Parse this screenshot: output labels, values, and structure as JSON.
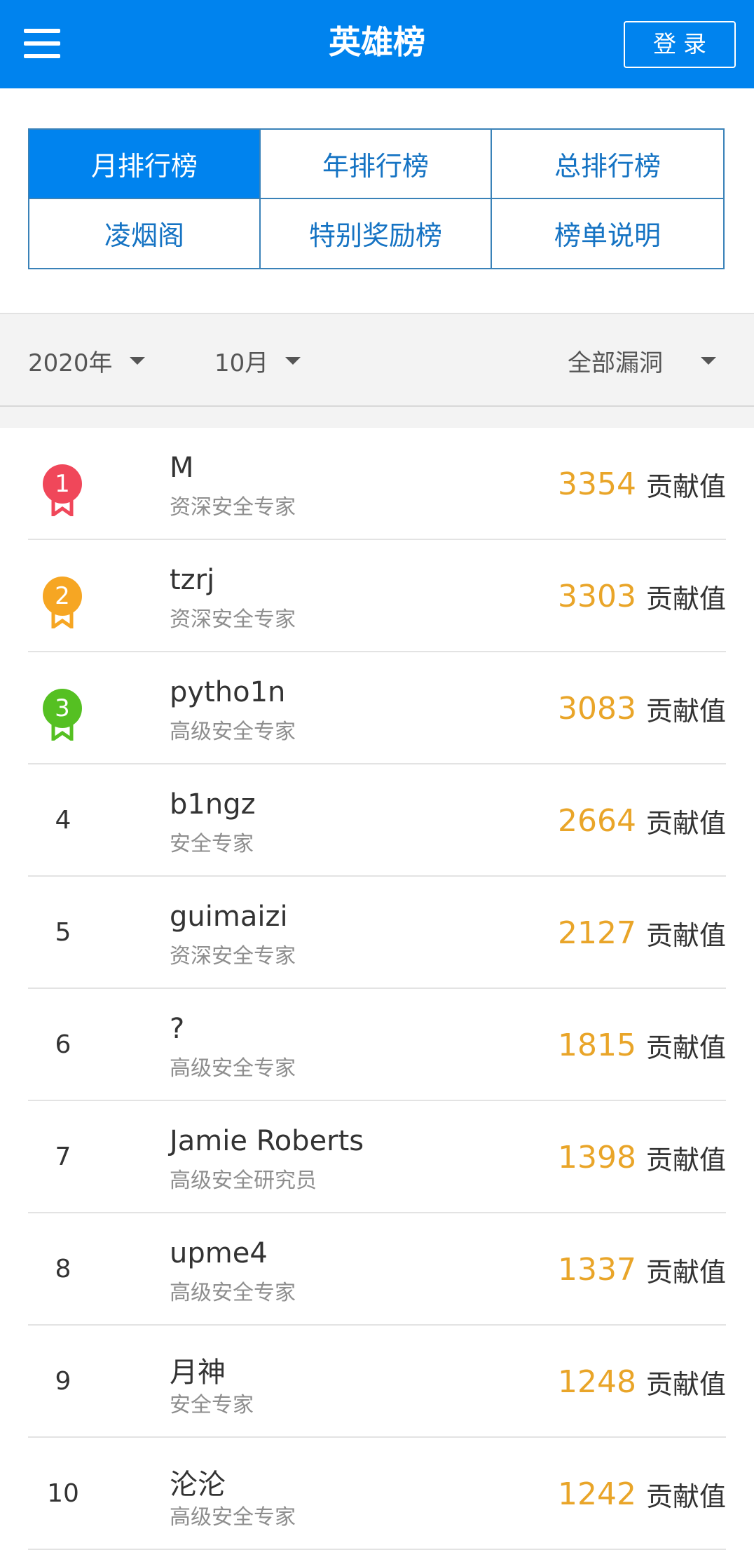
{
  "header": {
    "title": "英雄榜",
    "login_label": "登录"
  },
  "tabs": [
    {
      "label": "月排行榜",
      "active": true
    },
    {
      "label": "年排行榜",
      "active": false
    },
    {
      "label": "总排行榜",
      "active": false
    },
    {
      "label": "凌烟阁",
      "active": false
    },
    {
      "label": "特别奖励榜",
      "active": false
    },
    {
      "label": "榜单说明",
      "active": false
    }
  ],
  "filters": {
    "year": "2020年",
    "month": "10月",
    "vuln_type": "全部漏洞"
  },
  "colors": {
    "brand": "#0083ee",
    "score": "#e9a529",
    "medal_1": "#f0475a",
    "medal_2": "#f6a623",
    "medal_3": "#55c022"
  },
  "score_unit": "贡献值",
  "leaderboard": [
    {
      "rank": "1",
      "name": "M",
      "title": "资深安全专家",
      "score": "3354"
    },
    {
      "rank": "2",
      "name": "tzrj",
      "title": "资深安全专家",
      "score": "3303"
    },
    {
      "rank": "3",
      "name": "pytho1n",
      "title": "高级安全专家",
      "score": "3083"
    },
    {
      "rank": "4",
      "name": "b1ngz",
      "title": "安全专家",
      "score": "2664"
    },
    {
      "rank": "5",
      "name": "guimaizi",
      "title": "资深安全专家",
      "score": "2127"
    },
    {
      "rank": "6",
      "name": "?",
      "title": "高级安全专家",
      "score": "1815"
    },
    {
      "rank": "7",
      "name": "Jamie Roberts",
      "title": "高级安全研究员",
      "score": "1398"
    },
    {
      "rank": "8",
      "name": "upme4",
      "title": "高级安全专家",
      "score": "1337"
    },
    {
      "rank": "9",
      "name": "月神",
      "title": "安全专家",
      "score": "1248"
    },
    {
      "rank": "10",
      "name": "沦沦",
      "title": "高级安全专家",
      "score": "1242"
    }
  ]
}
